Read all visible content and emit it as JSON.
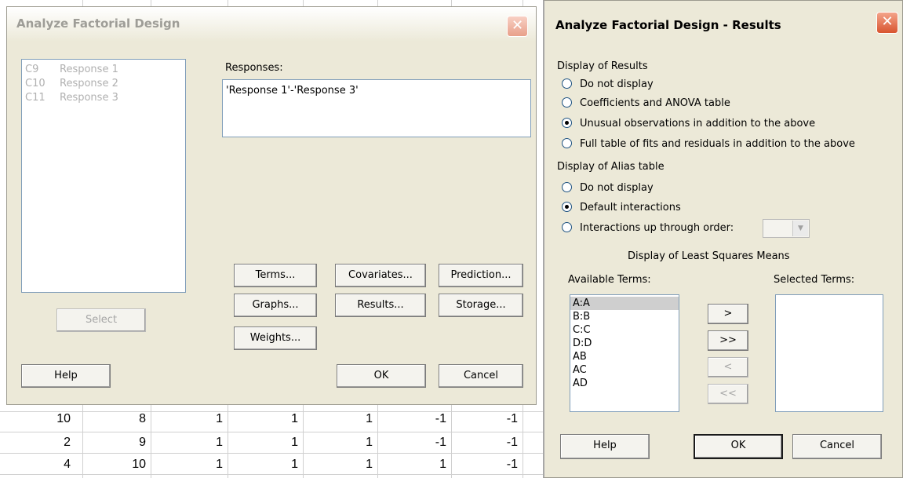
{
  "left_dialog": {
    "title": "Analyze Factorial Design",
    "columns": [
      {
        "id": "C9",
        "name": "Response 1"
      },
      {
        "id": "C10",
        "name": "Response 2"
      },
      {
        "id": "C11",
        "name": "Response 3"
      }
    ],
    "select_label": "Select",
    "responses_label": "Responses:",
    "responses_value": "'Response 1'-'Response 3'",
    "buttons": {
      "terms": "Terms...",
      "covariates": "Covariates...",
      "prediction": "Prediction...",
      "graphs": "Graphs...",
      "results": "Results...",
      "storage": "Storage...",
      "weights": "Weights..."
    },
    "help_label": "Help",
    "ok_label": "OK",
    "cancel_label": "Cancel"
  },
  "right_dialog": {
    "title": "Analyze Factorial Design - Results",
    "display_results_label": "Display of Results",
    "results_options": [
      {
        "label": "Do not display",
        "selected": false
      },
      {
        "label": "Coefficients and ANOVA table",
        "selected": false
      },
      {
        "label": "Unusual observations in addition to the above",
        "selected": true
      },
      {
        "label": "Full table of fits and residuals in addition to the above",
        "selected": false
      }
    ],
    "alias_label": "Display of Alias table",
    "alias_options": [
      {
        "label": "Do not display",
        "selected": false
      },
      {
        "label": "Default interactions",
        "selected": true
      },
      {
        "label": "Interactions up through order:",
        "selected": false
      }
    ],
    "lsm_label": "Display of Least Squares Means",
    "available_terms_label": "Available Terms:",
    "selected_terms_label": "Selected Terms:",
    "available_terms": [
      "A:A",
      "B:B",
      "C:C",
      "D:D",
      "AB",
      "AC",
      "AD"
    ],
    "move_buttons": {
      "add": ">",
      "add_all": ">>",
      "remove": "<",
      "remove_all": "<<"
    },
    "help_label": "Help",
    "ok_label": "OK",
    "cancel_label": "Cancel"
  },
  "worksheet": {
    "rows": [
      [
        "10",
        "8",
        "1",
        "1",
        "1",
        "-1",
        "-1"
      ],
      [
        "2",
        "9",
        "1",
        "1",
        "1",
        "-1",
        "-1"
      ],
      [
        "4",
        "10",
        "1",
        "1",
        "1",
        "1",
        "-1"
      ]
    ]
  }
}
